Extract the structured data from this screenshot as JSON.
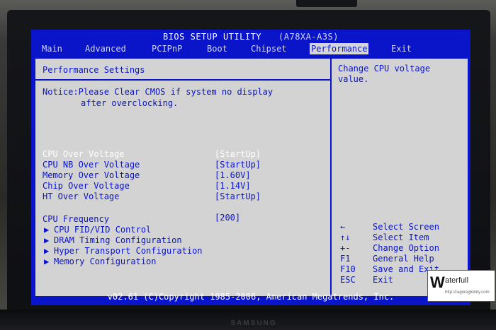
{
  "bios": {
    "title": "BIOS SETUP UTILITY",
    "model": "(A78XA-A3S)"
  },
  "menu": [
    "Main",
    "Advanced",
    "PCIPnP",
    "Boot",
    "Chipset",
    "Performance",
    "Exit"
  ],
  "active_menu": "Performance",
  "section_title": "Performance Settings",
  "notice": {
    "line1": "Notice:Please Clear CMOS if system no display",
    "line2": "after overclocking."
  },
  "settings": [
    {
      "label": "CPU Over Voltage",
      "value": "[StartUp]"
    },
    {
      "label": "CPU NB Over Voltage",
      "value": "[StartUp]"
    },
    {
      "label": "Memory Over Voltage",
      "value": "[1.60V]"
    },
    {
      "label": "Chip Over Voltage",
      "value": "[1.14V]"
    },
    {
      "label": "HT Over Voltage",
      "value": "[StartUp]"
    }
  ],
  "cpu_frequency": {
    "label": "CPU Frequency",
    "value": "[200]"
  },
  "submenus": [
    "CPU FID/VID Control",
    "DRAM Timing Configuration",
    "Hyper Transport Configuration",
    "Memory Configuration"
  ],
  "help_text": "Change CPU voltage value.",
  "keys": [
    {
      "key": "←",
      "desc": "Select Screen"
    },
    {
      "key": "↑↓",
      "desc": "Select Item"
    },
    {
      "key": "+-",
      "desc": "Change Option"
    },
    {
      "key": "F1",
      "desc": "General Help"
    },
    {
      "key": "F10",
      "desc": "Save and Exit"
    },
    {
      "key": "ESC",
      "desc": "Exit"
    }
  ],
  "footer": "v02.61 (C)Copyright 1985-2006, American Megatrends, Inc.",
  "brand": "SAMSUNG",
  "watermark": {
    "logo": "W",
    "text": "aterfull",
    "url": "http://ragoreglobiry.com"
  },
  "colors": {
    "bios_blue": "#0a14c8",
    "panel_gray": "#d3d3d3",
    "highlight_text": "#ffffff"
  }
}
